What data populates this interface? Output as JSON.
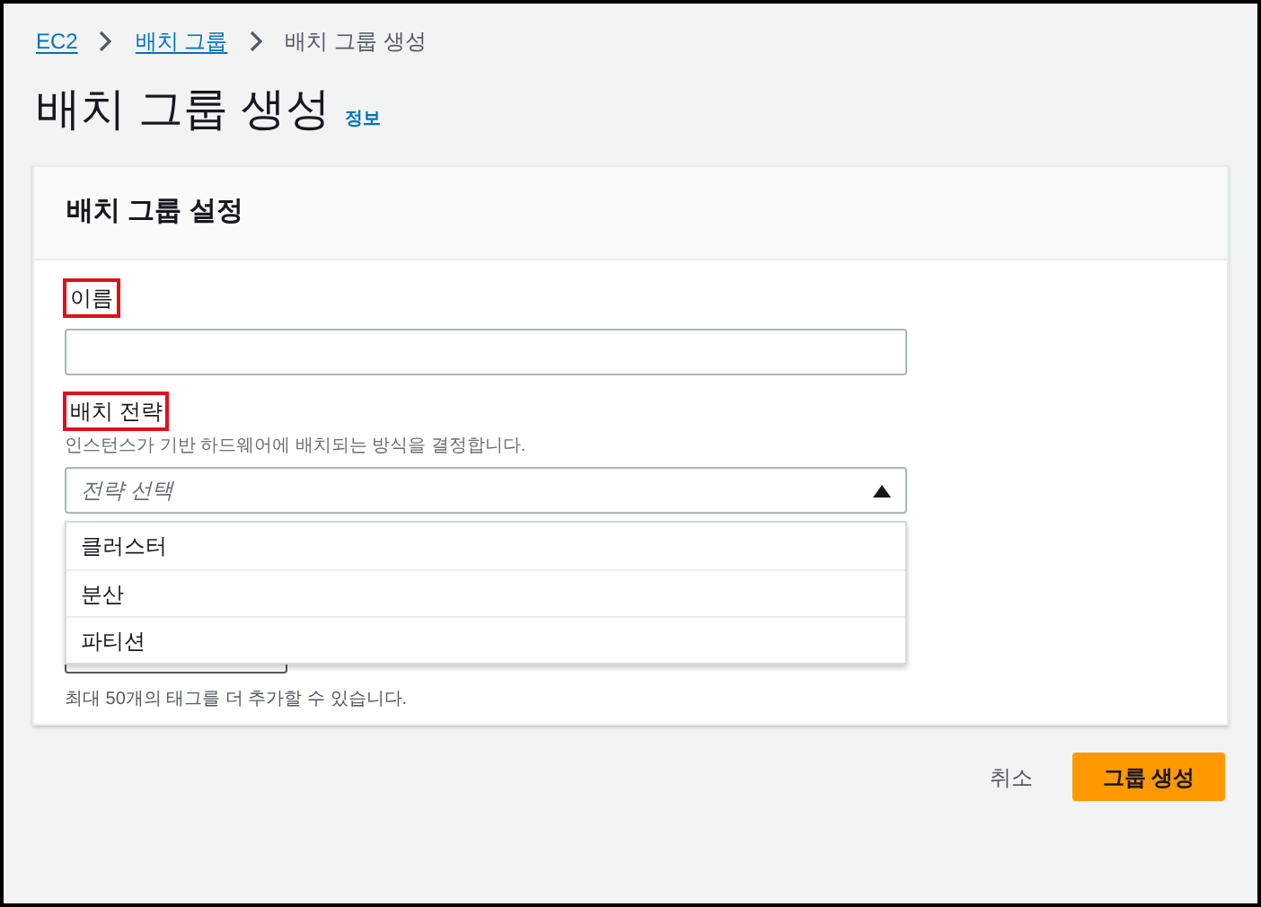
{
  "breadcrumb": [
    {
      "label": "EC2",
      "link": true
    },
    {
      "label": "배치 그룹",
      "link": true
    },
    {
      "label": "배치 그룹 생성",
      "link": false
    }
  ],
  "page": {
    "title": "배치 그룹 생성",
    "info_link": "정보"
  },
  "panel": {
    "title": "배치 그룹 설정",
    "name_field": {
      "label": "이름",
      "highlighted": true
    },
    "strategy_field": {
      "label": "배치 전략",
      "highlighted": true,
      "description": "인스턴스가 기반 하드웨어에 배치되는 방식을 결정합니다.",
      "placeholder": "전략 선택",
      "expanded": true,
      "options": [
        "클러스터",
        "분산",
        "파티션"
      ]
    },
    "tags_hint": "최대 50개의 태그를 더 추가할 수 있습니다."
  },
  "actions": {
    "cancel": "취소",
    "submit": "그룹 생성"
  }
}
